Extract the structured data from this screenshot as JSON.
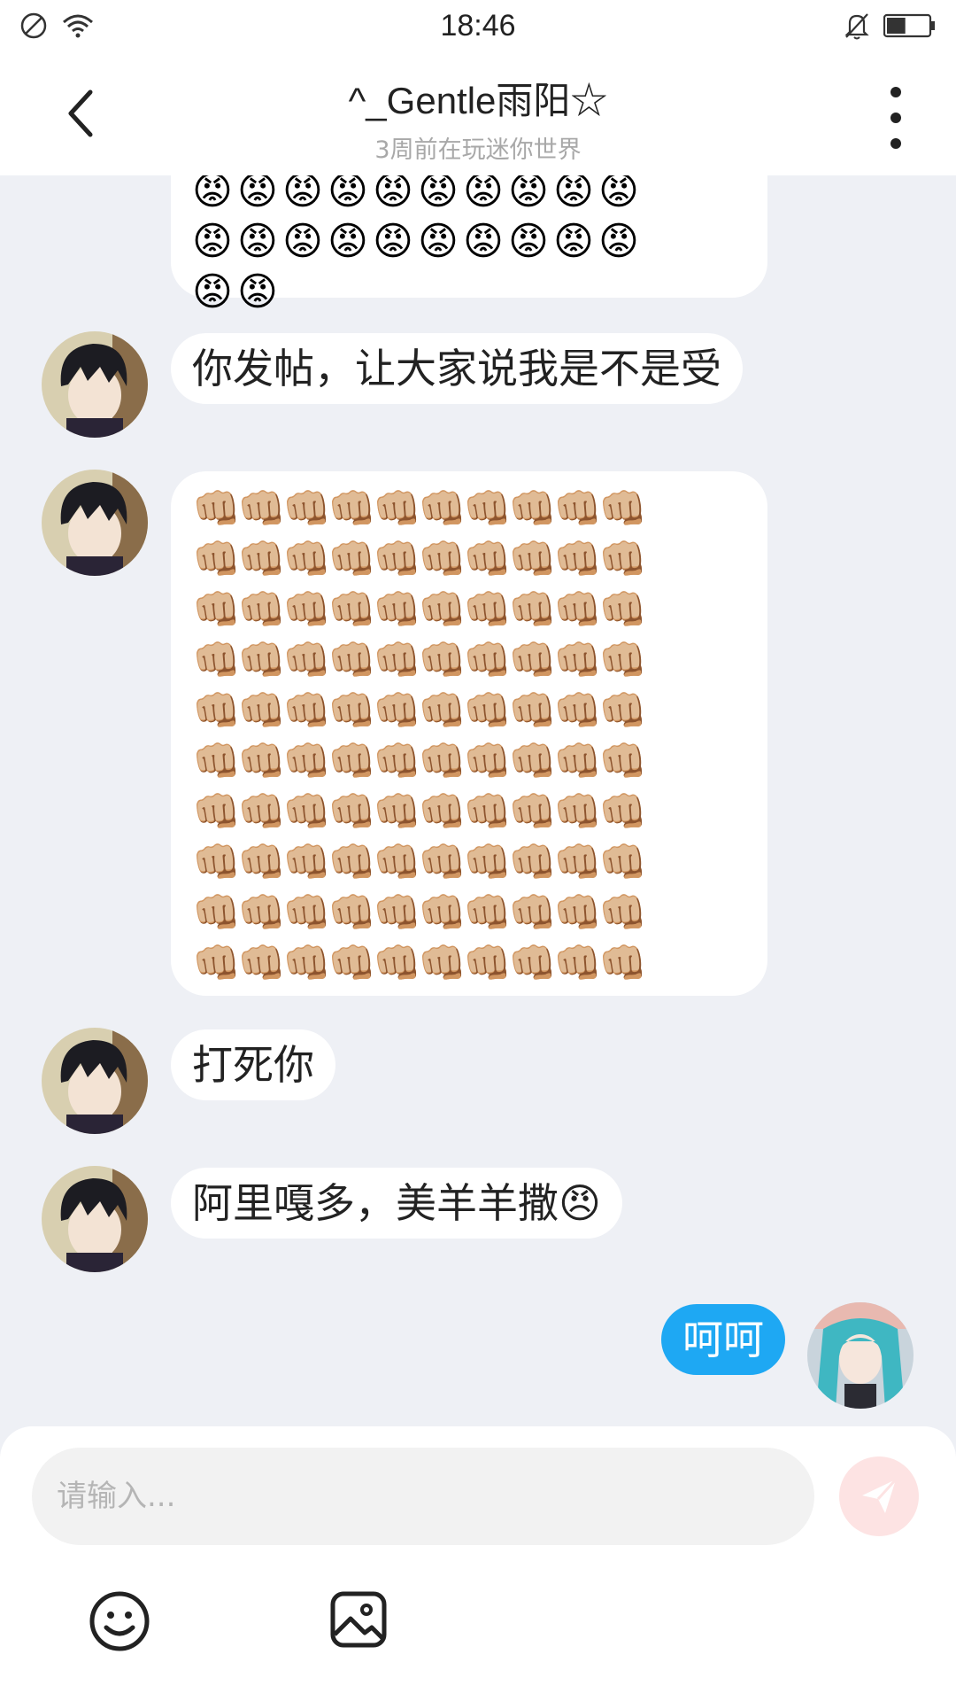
{
  "status_bar": {
    "time": "18:46",
    "battery_level": 0.45
  },
  "header": {
    "title": "^_Gentle雨阳☆",
    "subtitle": "3周前在玩迷你世界",
    "icons": {
      "back": "chevron-left-icon",
      "more": "more-vertical-icon"
    }
  },
  "messages": [
    {
      "from": "other",
      "type": "emoji-grid",
      "emoji": "😡",
      "count": 32
    },
    {
      "from": "other",
      "type": "text",
      "text": "你发帖，让大家说我是不是受"
    },
    {
      "from": "other",
      "type": "emoji-grid",
      "emoji": "👊🏼",
      "count": 100
    },
    {
      "from": "other",
      "type": "text",
      "text": "打死你"
    },
    {
      "from": "other",
      "type": "text",
      "text": "阿里嘎多，美羊羊撒😠"
    },
    {
      "from": "me",
      "type": "text",
      "text": "呵呵"
    }
  ],
  "composer": {
    "placeholder": "请输入...",
    "icons": {
      "send": "send-icon",
      "emoji": "emoji-smile-icon",
      "image": "image-icon"
    }
  },
  "colors": {
    "background": "#eef0f5",
    "my_bubble": "#1ea8f3",
    "send_button": "#fde3e3"
  }
}
